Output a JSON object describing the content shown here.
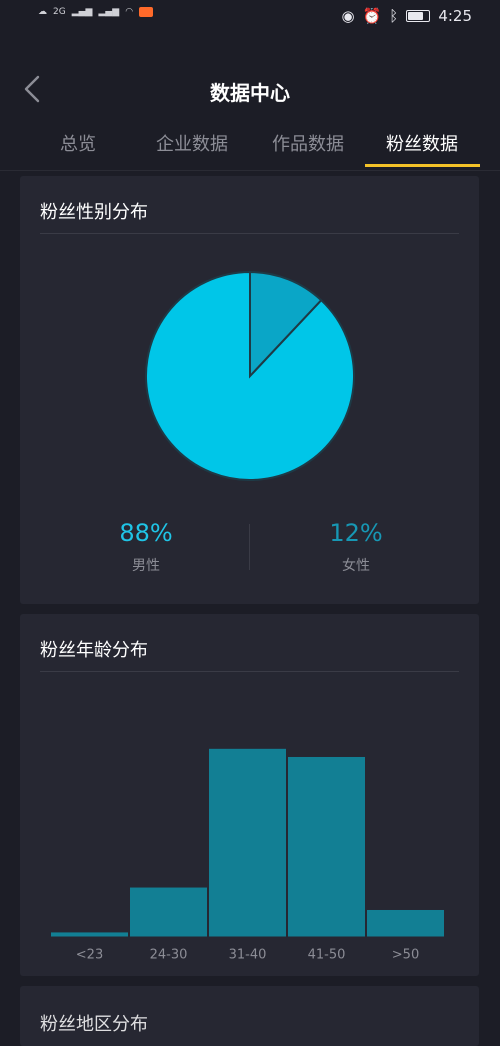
{
  "status_bar": {
    "time": "4:25",
    "signal_text": "2G"
  },
  "header": {
    "title": "数据中心",
    "back_icon": "chevron-left-icon"
  },
  "tabs": [
    {
      "label": "总览",
      "active": false
    },
    {
      "label": "企业数据",
      "active": false
    },
    {
      "label": "作品数据",
      "active": false
    },
    {
      "label": "粉丝数据",
      "active": true
    }
  ],
  "gender_card": {
    "title": "粉丝性别分布",
    "male": {
      "value": 88,
      "label_pct": "88%",
      "label": "男性",
      "color": "#00c6e8"
    },
    "female": {
      "value": 12,
      "label_pct": "12%",
      "label": "女性",
      "color": "#0aa6c7"
    }
  },
  "age_card": {
    "title": "粉丝年龄分布"
  },
  "chart_data": {
    "type": "bar",
    "categories": [
      "<23",
      "24-30",
      "31-40",
      "41-50",
      ">50"
    ],
    "values": [
      2,
      24,
      92,
      88,
      13
    ],
    "ylim": [
      0,
      100
    ],
    "bar_color": "#127f94",
    "grid": false
  },
  "next_card": {
    "title": "粉丝地区分布"
  }
}
